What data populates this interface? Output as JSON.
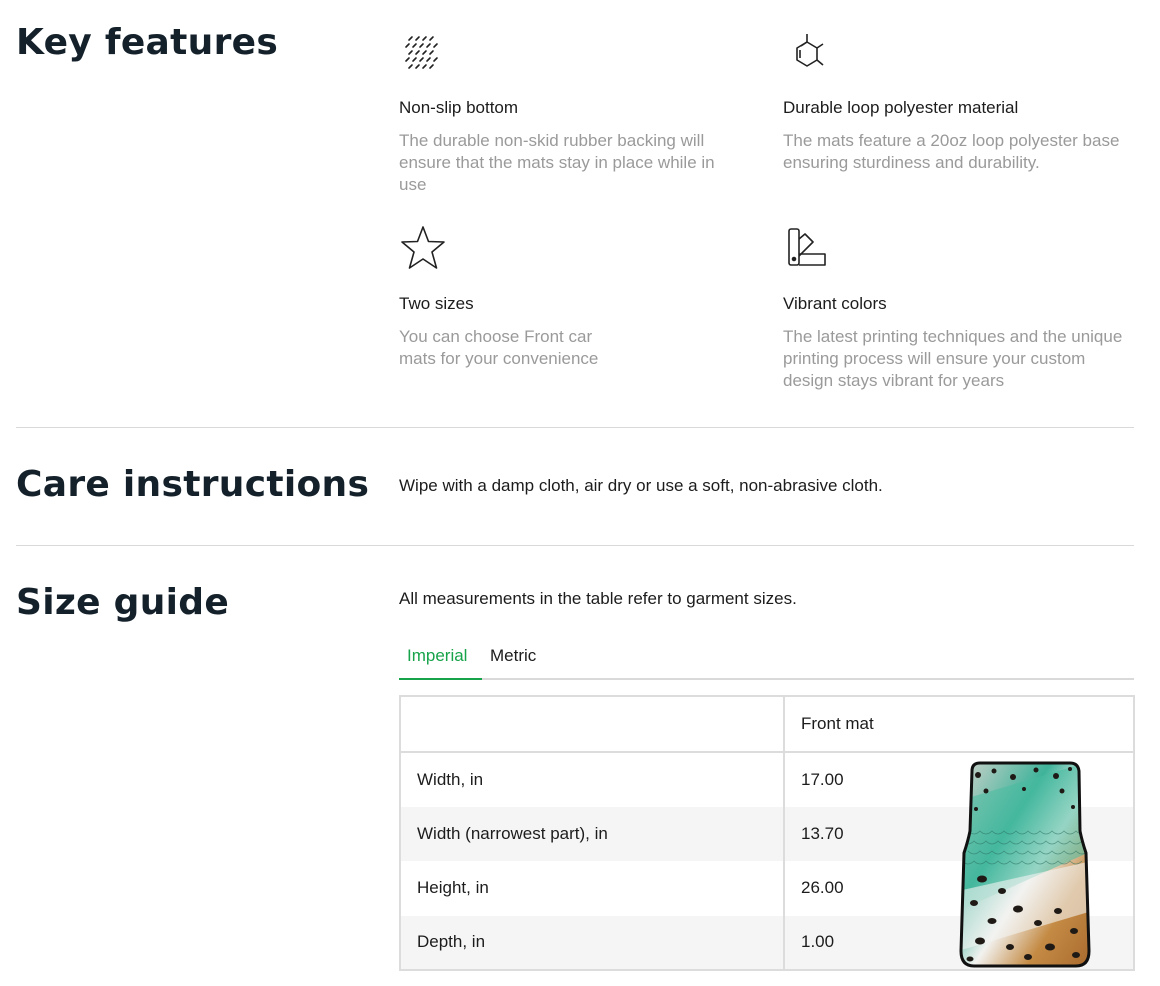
{
  "key_features": {
    "title": "Key features",
    "items": [
      {
        "icon": "texture-dots-icon",
        "title": "Non-slip bottom",
        "description": "The durable non-skid rubber backing will ensure that the mats stay in place while in use"
      },
      {
        "icon": "molecule-icon",
        "title": "Durable loop polyester material",
        "description": "The mats feature a 20oz loop polyester base ensuring sturdiness and durability."
      },
      {
        "icon": "star-icon",
        "title": "Two sizes",
        "description": "You can choose Front car mats for your convenience"
      },
      {
        "icon": "color-swatch-icon",
        "title": "Vibrant colors",
        "description": "The latest printing techniques and the unique printing process will ensure your custom design stays vibrant for years"
      }
    ]
  },
  "care": {
    "title": "Care instructions",
    "text": "Wipe with a damp cloth, air dry or use a soft, non-abrasive cloth."
  },
  "size_guide": {
    "title": "Size guide",
    "note": "All measurements in the table refer to garment sizes.",
    "tabs": [
      {
        "label": "Imperial",
        "active": true
      },
      {
        "label": "Metric",
        "active": false
      }
    ],
    "table": {
      "header": [
        "",
        "Front mat"
      ],
      "rows": [
        [
          "Width, in",
          "17.00"
        ],
        [
          "Width (narrowest part), in",
          "13.70"
        ],
        [
          "Height, in",
          "26.00"
        ],
        [
          "Depth, in",
          "1.00"
        ]
      ]
    }
  },
  "colors": {
    "accent": "#17a34a",
    "heading": "#14212b",
    "muted": "#9a9a9a"
  }
}
